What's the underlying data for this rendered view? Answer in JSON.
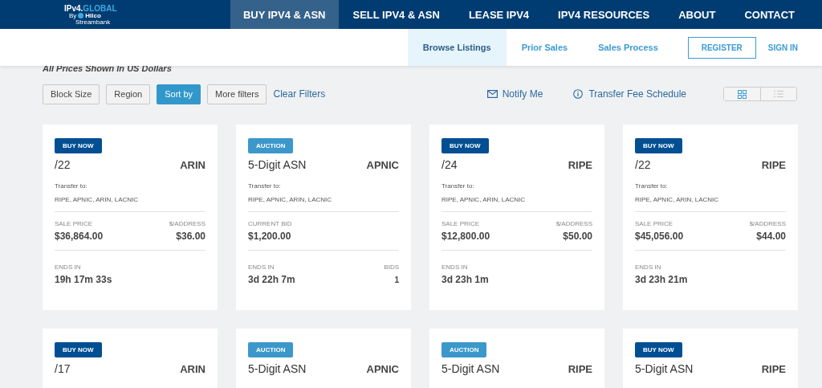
{
  "logo": {
    "prefix": "IPv4.",
    "suffix": "GLOBAL",
    "by": "By",
    "brand": "Hilco",
    "sub": "Streambank"
  },
  "nav": [
    {
      "label": "BUY IPV4 & ASN",
      "selected": true
    },
    {
      "label": "SELL IPV4 & ASN",
      "selected": false
    },
    {
      "label": "LEASE IPV4",
      "selected": false
    },
    {
      "label": "IPV4 RESOURCES",
      "selected": false
    },
    {
      "label": "ABOUT",
      "selected": false
    },
    {
      "label": "CONTACT",
      "selected": false
    }
  ],
  "subnav": [
    {
      "label": "Browse Listings",
      "selected": true
    },
    {
      "label": "Prior Sales",
      "selected": false
    },
    {
      "label": "Sales Process",
      "selected": false
    }
  ],
  "register": "REGISTER",
  "sign_in": "SIGN IN",
  "notice": "All Prices Shown In US Dollars",
  "filters": [
    {
      "label": "Block Size",
      "selected": false
    },
    {
      "label": "Region",
      "selected": false
    },
    {
      "label": "Sort by",
      "selected": true
    },
    {
      "label": "More filters",
      "selected": false
    }
  ],
  "clear_filters": "Clear Filters",
  "notify": "Notify Me",
  "fee_schedule": "Transfer Fee Schedule",
  "view": [
    {
      "kind": "grid",
      "selected": true
    },
    {
      "kind": "list",
      "selected": false
    }
  ],
  "listings": [
    {
      "kind": "buy_now",
      "badge": "BUY NOW",
      "title": "/22",
      "registry": "ARIN",
      "transfer_label": "Transfer to:",
      "transfer_to": "RIPE, APNIC, ARIN, LACNIC",
      "price_label": "SALE PRICE",
      "price": "$36,864.00",
      "per_label": "$/ADDRESS",
      "per_value": "$36.00",
      "ends_label": "ENDS IN",
      "ends": "19h 17m 33s"
    },
    {
      "kind": "auction",
      "badge": "AUCTION",
      "title": "5-Digit ASN",
      "registry": "APNIC",
      "transfer_label": "Transfer to:",
      "transfer_to": "RIPE, APNIC, ARIN, LACNIC",
      "price_label": "CURRENT BID",
      "price": "$1,200.00",
      "ends_label": "ENDS IN",
      "ends": "3d 22h 7m",
      "bids_label": "BIDS",
      "bids": "1"
    },
    {
      "kind": "buy_now",
      "badge": "BUY NOW",
      "title": "/24",
      "registry": "RIPE",
      "transfer_label": "Transfer to:",
      "transfer_to": "RIPE, APNIC, ARIN, LACNIC",
      "price_label": "SALE PRICE",
      "price": "$12,800.00",
      "per_label": "$/ADDRESS",
      "per_value": "$50.00",
      "ends_label": "ENDS IN",
      "ends": "3d 23h 1m"
    },
    {
      "kind": "buy_now",
      "badge": "BUY NOW",
      "title": "/22",
      "registry": "RIPE",
      "transfer_label": "Transfer to:",
      "transfer_to": "RIPE, APNIC, ARIN, LACNIC",
      "price_label": "SALE PRICE",
      "price": "$45,056.00",
      "per_label": "$/ADDRESS",
      "per_value": "$44.00",
      "ends_label": "ENDS IN",
      "ends": "3d 23h 21m"
    },
    {
      "kind": "buy_now",
      "badge": "BUY NOW",
      "title": "/17",
      "registry": "ARIN"
    },
    {
      "kind": "auction",
      "badge": "AUCTION",
      "title": "5-Digit ASN",
      "registry": "APNIC"
    },
    {
      "kind": "auction",
      "badge": "AUCTION",
      "title": "5-Digit ASN",
      "registry": "RIPE"
    },
    {
      "kind": "buy_now",
      "badge": "BUY NOW",
      "title": "5-Digit ASN",
      "registry": "RIPE"
    }
  ]
}
